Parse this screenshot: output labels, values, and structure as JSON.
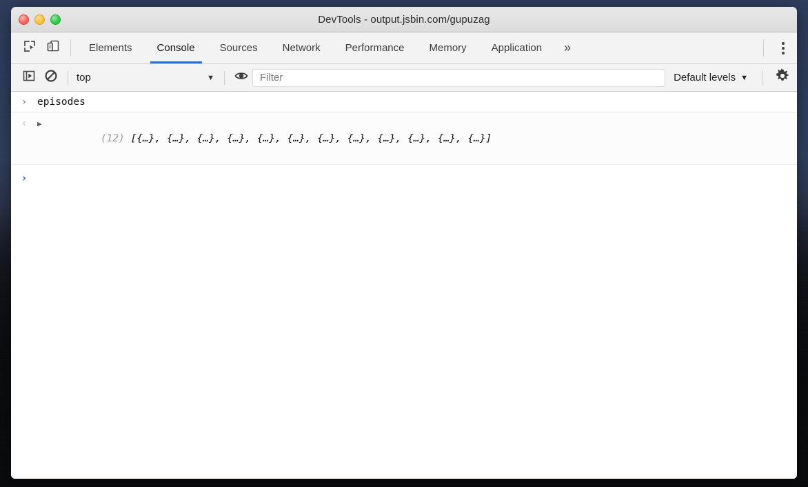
{
  "window": {
    "title": "DevTools - output.jsbin.com/gupuzag",
    "traffic_lights": [
      {
        "name": "close",
        "color": "#ff5f57"
      },
      {
        "name": "minimize",
        "color": "#febc2e"
      },
      {
        "name": "maximize",
        "color": "#28c840"
      }
    ]
  },
  "toolbar": {
    "inspect_icon": "inspect-element-icon",
    "device_icon": "device-toolbar-icon",
    "tabs": [
      {
        "label": "Elements",
        "active": false
      },
      {
        "label": "Console",
        "active": true
      },
      {
        "label": "Sources",
        "active": false
      },
      {
        "label": "Network",
        "active": false
      },
      {
        "label": "Performance",
        "active": false
      },
      {
        "label": "Memory",
        "active": false
      },
      {
        "label": "Application",
        "active": false
      }
    ],
    "overflow_label": "»",
    "more_icon": "kebab-menu-icon",
    "active_tab_color": "#1a73e8"
  },
  "filterbar": {
    "sidebar_toggle_icon": "console-sidebar-toggle-icon",
    "clear_icon": "clear-console-icon",
    "context": {
      "value": "top",
      "caret": "▼"
    },
    "eye_icon": "live-expression-eye-icon",
    "filter": {
      "placeholder": "Filter",
      "value": ""
    },
    "levels": {
      "label": "Default levels",
      "caret": "▼"
    },
    "settings_icon": "gear-icon"
  },
  "console": {
    "messages": [
      {
        "type": "command",
        "gutter": "›",
        "text": "episodes"
      },
      {
        "type": "result",
        "gutter": "‹",
        "expander": "▶",
        "count": "(12)",
        "value": "[{…}, {…}, {…}, {…}, {…}, {…}, {…}, {…}, {…}, {…}, {…}, {…}]"
      }
    ],
    "prompt": {
      "chevron": "›",
      "value": ""
    }
  }
}
